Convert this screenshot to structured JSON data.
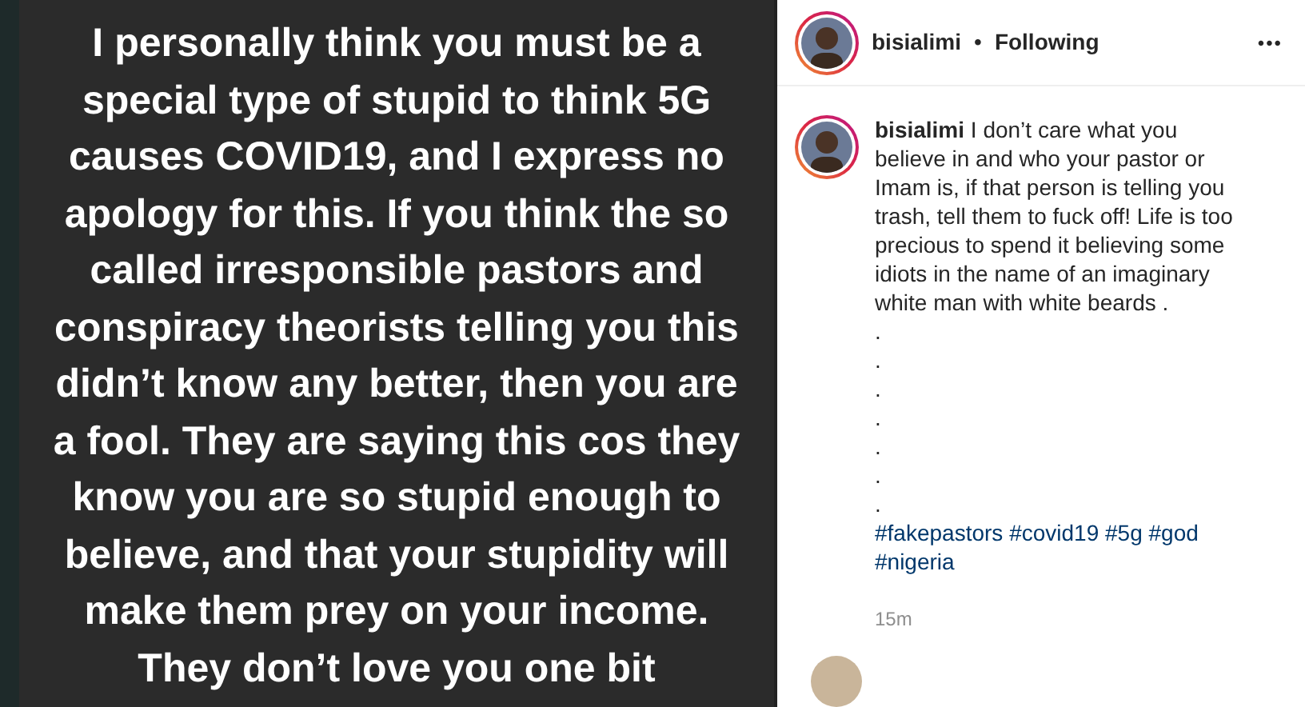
{
  "post_image": {
    "kind": "text_graphic",
    "lines": [
      "I personally think you must be a",
      "special type of stupid to think 5G",
      "causes COVID19, and I express no",
      "apology for this. If you think the so",
      "called irresponsible pastors and",
      "conspiracy theorists telling you this",
      "didn’t know any better, then you are",
      "a fool. They are saying this cos they",
      "know you are so stupid enough to",
      "believe, and that your stupidity will",
      "make them prey on your income.",
      "They don’t love you one bit"
    ]
  },
  "header": {
    "username": "bisialimi",
    "separator": "•",
    "follow_status": "Following",
    "more": "•••"
  },
  "caption": {
    "username": "bisialimi",
    "text": "I don’t care what you believe in and who your pastor or Imam is, if that person is telling you trash, tell them to fuck off! Life is too precious to spend it believing some idiots in the name of an imaginary white man with white beards .",
    "dots": [
      ".",
      ".",
      ".",
      ".",
      ".",
      ".",
      "."
    ],
    "hashtags": [
      "#fakepastors",
      "#covid19",
      "#5g",
      "#god",
      "#nigeria"
    ],
    "time": "15m"
  }
}
